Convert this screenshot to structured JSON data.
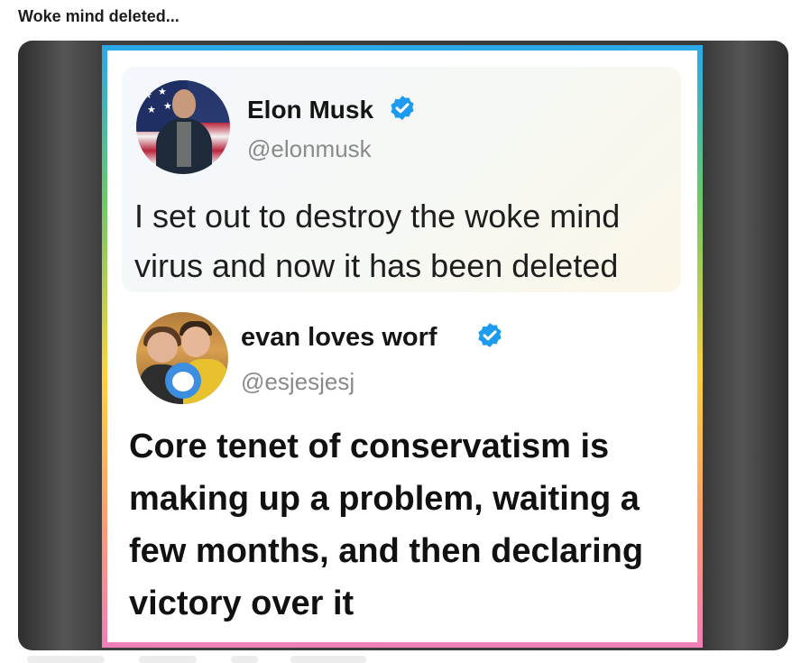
{
  "post": {
    "title": "Woke mind deleted..."
  },
  "tweets": [
    {
      "name": "Elon Musk",
      "handle": "@elonmusk",
      "verified": true,
      "text": "I set out to destroy the woke mind virus and now it has been deleted"
    },
    {
      "name": "evan loves worf",
      "handle": "@esjesjesj",
      "verified": true,
      "text": "Core tenet of conservatism is making up a problem, waiting a few months, and then declaring victory over it"
    }
  ],
  "colors": {
    "verified_badge": "#1d9bf0",
    "handle": "#8a8a8a",
    "frame_background": "#3a3a3a"
  }
}
